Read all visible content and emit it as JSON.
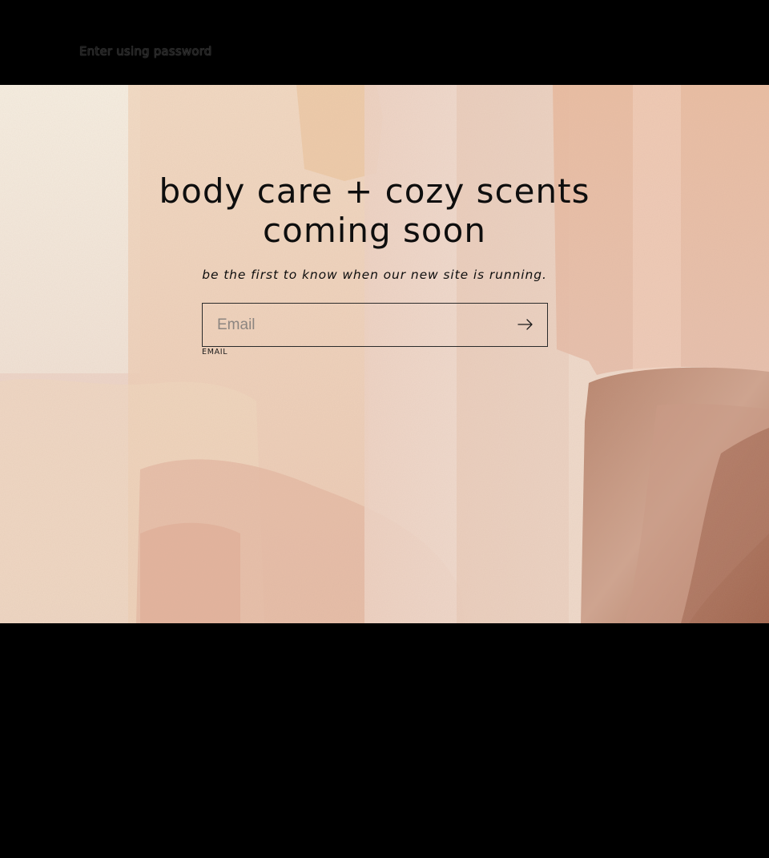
{
  "header": {
    "password_link": "Enter using password"
  },
  "hero": {
    "headline_line1": "body care + cozy scents",
    "headline_line2": "coming soon",
    "subtext": "be the first to know when our new site is running.",
    "email_placeholder": "Email",
    "email_value": "",
    "email_label": "EMAIL",
    "submit_icon": "arrow-right-icon"
  },
  "colors": {
    "page_background": "#000000",
    "text": "#0e0e0e",
    "input_border": "#2b2b2b"
  }
}
